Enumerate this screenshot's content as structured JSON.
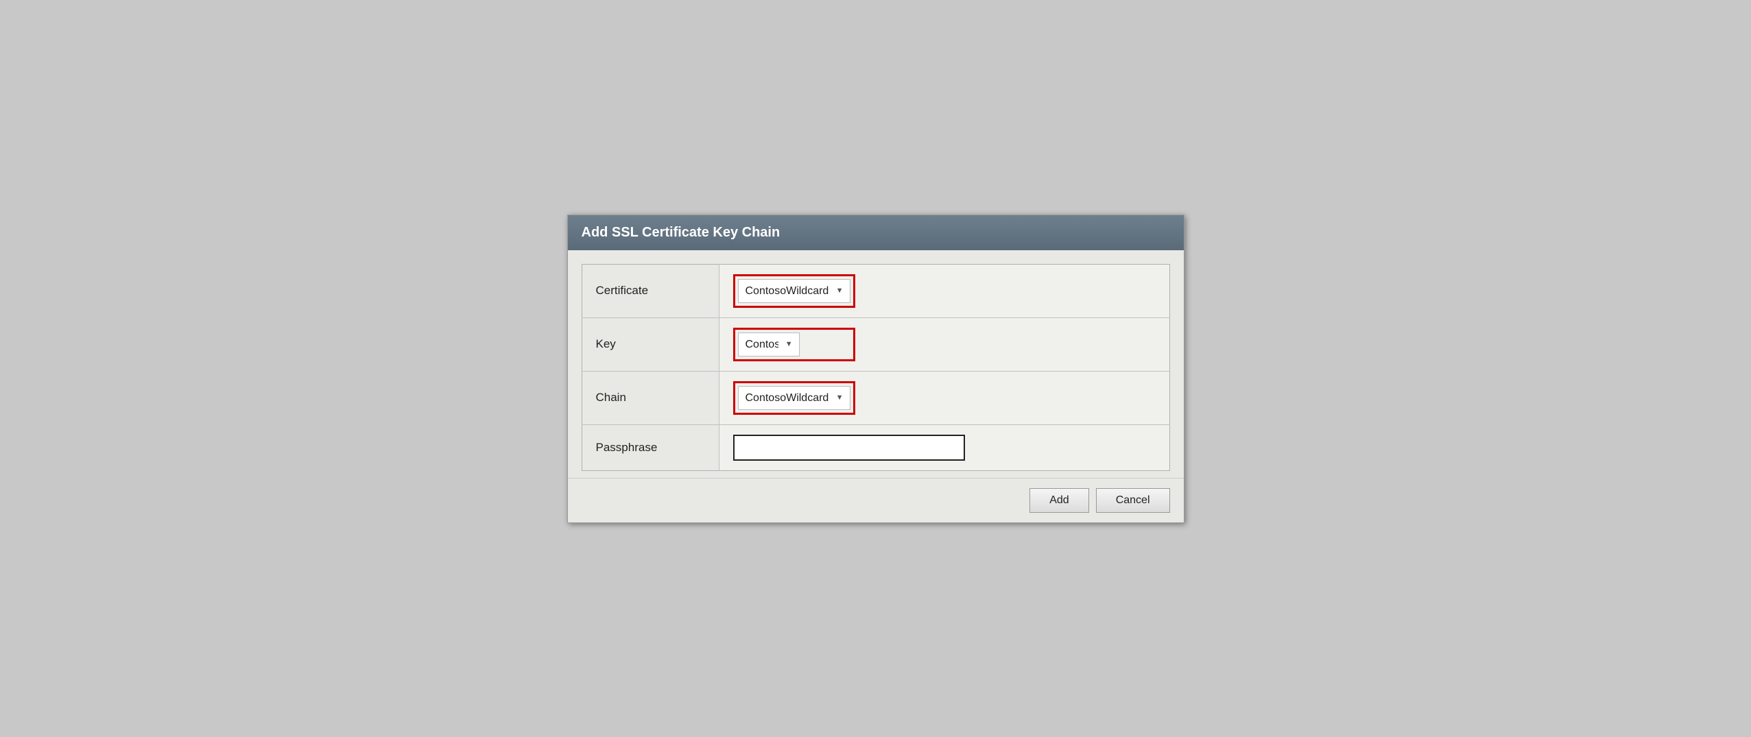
{
  "dialog": {
    "title": "Add SSL Certificate Key Chain",
    "fields": [
      {
        "id": "certificate",
        "label": "Certificate",
        "type": "select",
        "value": "ContosoWildcard",
        "options": [
          "ContosoWildcard"
        ],
        "highlighted": true,
        "width": "full"
      },
      {
        "id": "key",
        "label": "Key",
        "type": "select",
        "value": "ContosoWildcard",
        "options": [
          "ContosoWildcard"
        ],
        "highlighted": true,
        "width": "short"
      },
      {
        "id": "chain",
        "label": "Chain",
        "type": "select",
        "value": "ContosoWildcard",
        "options": [
          "ContosoWildcard"
        ],
        "highlighted": true,
        "width": "full"
      },
      {
        "id": "passphrase",
        "label": "Passphrase",
        "type": "password",
        "value": "",
        "placeholder": "",
        "highlighted": false
      }
    ],
    "buttons": {
      "add": "Add",
      "cancel": "Cancel"
    }
  }
}
